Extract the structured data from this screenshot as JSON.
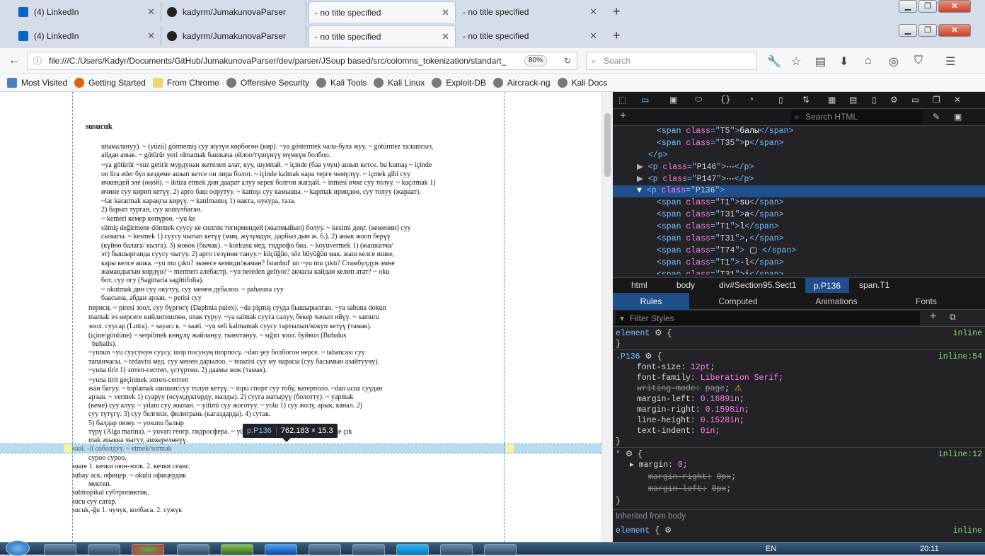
{
  "browser": {
    "tabs": [
      {
        "label": "(4) LinkedIn",
        "icon": "linkedin-icon"
      },
      {
        "label": "kadyrm/JumakunovaParser",
        "icon": "github-icon"
      },
      {
        "label": "- no title specified",
        "icon": "none"
      },
      {
        "label": "- no title specified",
        "icon": "none"
      }
    ],
    "new_tab": "+",
    "url": "file:///C:/Users/Kadyr/Documents/GitHub/JumakunovaParser/dev/parser/JSoup based/src/colomns_tokenization/standart_",
    "zoom": "80%",
    "search_placeholder": "Search",
    "bookmarks": [
      "Most Visited",
      "Getting Started",
      "From Chrome",
      "Offensive Security",
      "Kali Tools",
      "Kali Linux",
      "Exploit-DB",
      "Aircrack-ng",
      "Kali Docs"
    ]
  },
  "document": {
    "heading": "susucuk",
    "lines": [
      "шымалануу). ~ (yüzü) görmemiş суу жүзүн көрбөгөн (кир). ~ya göstermek чала-була жуу. ~ götürmez талашсыз,",
      "айдан ачык. ~ götürür yeri olmamak башкача ойлоо/түшүнүү мүмкүн болбоо.",
      "~ya götürür ~suz getirir мурдунан жетелеп алат, куу, шумпай. ~ içinde (баа учун) ашып кетсе. bu kumaş ~ içinde",
      "on lira eder бул кездеме ашып кетсе он лира болот. ~ içinde kalmak кара терге чөмүлүү. ~ içmek gibi суу",
      "ичкендей эле (оңой). ~ iktiza etmek дин даарат алуу керек болгон жагдай. ~ inmesi ичке суу толуу. ~ kaçırmak 1)",
      "ичине суу кирип кетүү. 2) арго баш оорутуу. ~ kamışı суу камышы. ~ kapmak ириңдөө, суу толуу (жараат).",
      "~lar kararmak караңгы кирүү. ~ katılmamış 1) накта, нукура, таза.",
      "2) барып турган, суу кошулбаган.",
      "~ kemeri кемер көпүрөө. ~yu ke",
      "silmiş değirmene dönmek суусу ке силген тегирмендей (жылмыйып) болуу. ~ kesimi деңг. (кеменин) суу",
      "сызыгы. ~ kesmek 1) суусу чыгып кетүү (миң. жүзүмдүн, дарбыз дын ж. б.). 2) анык жооп берүү",
      "(күйөө балага/ кызга). 3) мокок (бычак). ~ korkusu мед. гидрофо биа. ~ koyuvermek 1) (жашылча/",
      "эт) бышырганда суусу чыгуу. 2) арго сезүнөн тануу.~ küçüğün, söz büyüğün мак. жаш келсе ишке,",
      "кары келсе ашка. ~yu mu çıktı? зынесе кемиди/жаман? İstanbul' un ~yu mu çıktı? Стамбулдун эмне",
      "жамандыгын көрдүн? ~ mermeri алебастр. ~yu nereden geliyor? акчасы кайдан келип атат? ~ oku",
      "бот. суу огу (Sagittaria sagittifolia).",
      "~ okutmak дин суу окутуу, суу менен дубалоо. ~ pahasına суу",
      "баасына, абдан арзан. ~ perisi суу",
      "периси. ~ piresi зоол. суу бүргөсү (Daphnia pulex). ~da pişmiş сууда бышырылган. ~ya sabuna dokun",
      "mamak эч нерсеге кийлигишпөө, олак туруу. ~ya salmak суугa салуу, бекер чачып ийүү. ~ samuru",
      "зоол. суусар (Lutra). ~ sayacı к. ~ saati. ~yu seli kalmamak суусу тартылып/кокуп кетүү (тамак).",
      "(içine/gönlüne) ~ serpilmek көңүлү жайлануу, тынчтануу. ~ sığırı зоол. буйвол (Bubalus",
      "bubalis).",
      "~yunun ~yu суусунун суусу, шор посунуң шорпосу. ~dan şey болбогон нерсе. ~ tabancası суу",
      "тапанчасы. ~ tedavisi мед. суу менен дарылоо. ~ terazisi суу му нарасы (суу басымын азайтуучу).",
      "~yuna tirit 1) эптеп-септеп, үстүртөн. 2) даамы жок (тамак).",
      "~yuna tirit geçinmek эптеп-септеп",
      "жан багуу. ~ toplamak шишип/суу толуп кетүү. ~ topu спорт суу тобу, ватерполо. ~dan ucuz суудан",
      "арзан. ~ vermek 1) суаруу (өсүмдүктөрдү, малды). 2) суугa матырүү (болотту). ~ yapmak",
      "(кеме) суу алуу. ~ yılanı суу жылан. ~ yitimi суу жоготуу. ~ yolu 1) суу жолу, арык, канал. 2)",
      "суу түтүгү. 3) суу белгиси, филигрань (кагаздарда). 4) сутак.",
      "5) балдар оюну. ~ yosunu балыр",
      "түрү (Alga marina). ~ yuvarı геогр. гидросфера. ~ yüzü (k tar) бүчүр байлоо. ~ yüzüne çık",
      "mak ачыкка чыгуу, ашкерелөнүү.",
      "sual. -li соболдуу. ~ etmek/sormak",
      "суроо суроо.",
      "suare 1. кечки оюн-зоок. 2. кечки сеанс.",
      "subay аск. офицер. ~ okulu офицердик",
      "мектеп.",
      "subtropikal субтропиктик.",
      "sucu суу сатар.",
      "sucuk,-ğu 1. чучук, колбаса. 2. сужук"
    ]
  },
  "inspector_tooltip": {
    "selector": "p.P136",
    "dims": "762.183 × 15.3"
  },
  "devtools": {
    "search_placeholder": "Search HTML",
    "tree": [
      {
        "indent": 4,
        "tag": "span",
        "cls": "T5",
        "text": "балы",
        "close": true
      },
      {
        "indent": 4,
        "tag": "span",
        "cls": "T35",
        "text": "р",
        "close": true
      },
      {
        "indent": 3,
        "raw": "</p>"
      },
      {
        "indent": 3,
        "arrow": "▶",
        "tag": "p",
        "cls": "P146",
        "collapsed": true
      },
      {
        "indent": 3,
        "arrow": "▶",
        "tag": "p",
        "cls": "P147",
        "collapsed": true
      },
      {
        "indent": 3,
        "arrow": "▼",
        "tag": "p",
        "cls": "P136",
        "selected": true
      },
      {
        "indent": 4,
        "tag": "span",
        "cls": "T1",
        "text": "su",
        "close": true
      },
      {
        "indent": 4,
        "tag": "span",
        "cls": "T31",
        "text": "a",
        "close": true
      },
      {
        "indent": 4,
        "tag": "span",
        "cls": "T1",
        "text": "l",
        "close": true
      },
      {
        "indent": 4,
        "tag": "span",
        "cls": "T31",
        "text": ",",
        "close": true
      },
      {
        "indent": 4,
        "tag": "span",
        "cls": "T74",
        "text": " ▢ ",
        "close": true
      },
      {
        "indent": 4,
        "tag": "span",
        "cls": "T1",
        "text": "-l",
        "close": true
      },
      {
        "indent": 4,
        "tag": "span",
        "cls": "T31",
        "text": "i",
        "close": true
      }
    ],
    "breadcrumbs": [
      "html",
      "body",
      "div#Section95.Sect1",
      "p.P136",
      "span.T1"
    ],
    "rule_tabs": [
      "Rules",
      "Computed",
      "Animations",
      "Fonts"
    ],
    "filter_placeholder": "Filter Styles",
    "rules": {
      "element_selector": "element",
      "element_source": "inline",
      "p136_selector": ".P136",
      "p136_source": "inline:54",
      "props": [
        {
          "name": "font-size",
          "value": "12pt"
        },
        {
          "name": "font-family",
          "value": "Liberation Serif"
        },
        {
          "name": "writing-mode",
          "value": "page",
          "struck": true,
          "warn": true
        },
        {
          "name": "margin-left",
          "value": "0.1689in"
        },
        {
          "name": "margin-right",
          "value": "0.1598in"
        },
        {
          "name": "line-height",
          "value": "0.1528in"
        },
        {
          "name": "text-indent",
          "value": "0in"
        }
      ],
      "star_selector": "*",
      "star_source": "inline:12",
      "star_props": [
        {
          "name": "margin",
          "value": "0"
        },
        {
          "name": "margin-right",
          "value": "0px",
          "struck": true
        },
        {
          "name": "margin-left",
          "value": "0px",
          "struck": true
        }
      ],
      "inherited": "Inherited from body",
      "last_selector": "element",
      "last_source": "inline"
    }
  },
  "taskbar": {
    "lang": "EN",
    "time": "20:11"
  }
}
